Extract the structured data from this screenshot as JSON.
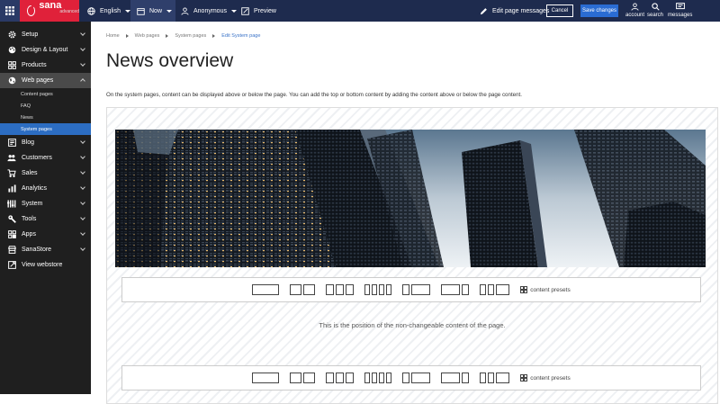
{
  "topbar": {
    "logo": {
      "name": "sana",
      "edition": "advanced"
    },
    "language": "English",
    "time": "Now",
    "visitor": "Anonymous",
    "preview": "Preview",
    "edit_messages": "Edit page messages",
    "cancel": "Cancel",
    "save": "Save changes",
    "icons": [
      {
        "label": "account",
        "icon": "user-icon"
      },
      {
        "label": "search",
        "icon": "search-icon"
      },
      {
        "label": "messages",
        "icon": "messages-icon"
      }
    ]
  },
  "sidebar": {
    "items": [
      {
        "label": "Setup",
        "icon": "gear-icon"
      },
      {
        "label": "Design & Layout",
        "icon": "palette-icon"
      },
      {
        "label": "Products",
        "icon": "products-icon"
      },
      {
        "label": "Web pages",
        "icon": "globe-icon",
        "active": true
      },
      {
        "label": "Blog",
        "icon": "blog-icon"
      },
      {
        "label": "Customers",
        "icon": "customers-icon"
      },
      {
        "label": "Sales",
        "icon": "cart-icon"
      },
      {
        "label": "Analytics",
        "icon": "analytics-icon"
      },
      {
        "label": "System",
        "icon": "system-icon"
      },
      {
        "label": "Tools",
        "icon": "wrench-icon"
      },
      {
        "label": "Apps",
        "icon": "apps-icon"
      },
      {
        "label": "SanaStore",
        "icon": "store-icon"
      },
      {
        "label": "View webstore",
        "icon": "external-link-icon"
      }
    ],
    "subitems": [
      "Content pages",
      "FAQ",
      "News",
      "System pages"
    ],
    "selected_subitem": "System pages"
  },
  "breadcrumb": [
    "Home",
    "Web pages",
    "System pages",
    "Edit System page"
  ],
  "page": {
    "title": "News overview",
    "intro": "On the system pages, content can be displayed above or below the page. You can add the top or bottom content by adding the content above or below the page content.",
    "fixed_content": "This is the position of the non-changeable content of the page.",
    "presets_label": "content presets"
  },
  "colors": {
    "topbar": "#1e2b4e",
    "logo": "#e0213a",
    "sidebar": "#1f1f1f",
    "accent": "#2c6dc2",
    "save": "#2a6cd3"
  }
}
